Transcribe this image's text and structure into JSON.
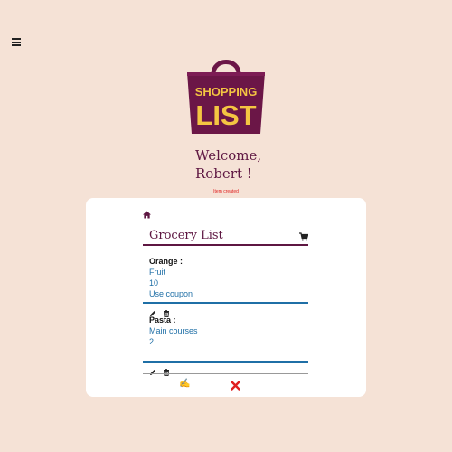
{
  "header": {
    "menu_icon": "hamburger-menu-icon"
  },
  "logo": {
    "line1": "SHOPPING",
    "line2": "LIST",
    "bag_color": "#6b1647",
    "text_color": "#f4c542"
  },
  "welcome": {
    "line1": "Welcome,",
    "line2": "Robert !"
  },
  "flash_message": "Item created",
  "card": {
    "home_icon": "home-icon",
    "title": "Grocery List",
    "cart_icon": "cart-icon",
    "items": [
      {
        "name": "Orange :",
        "category": "Fruit",
        "quantity": "10",
        "note": "Use coupon"
      },
      {
        "name": "Pasta :",
        "category": "Main courses",
        "quantity": "2"
      }
    ],
    "item_actions": {
      "edit_icon": "pencil-icon",
      "delete_icon": "trash-icon"
    },
    "footer": {
      "edit_icon": "writing-hand-icon",
      "close_icon": "red-x-icon",
      "edit_glyph": "✍"
    }
  },
  "colors": {
    "background": "#f5e2d6",
    "accent": "#5e1742",
    "link": "#1f6fa6",
    "error": "#e02020"
  }
}
